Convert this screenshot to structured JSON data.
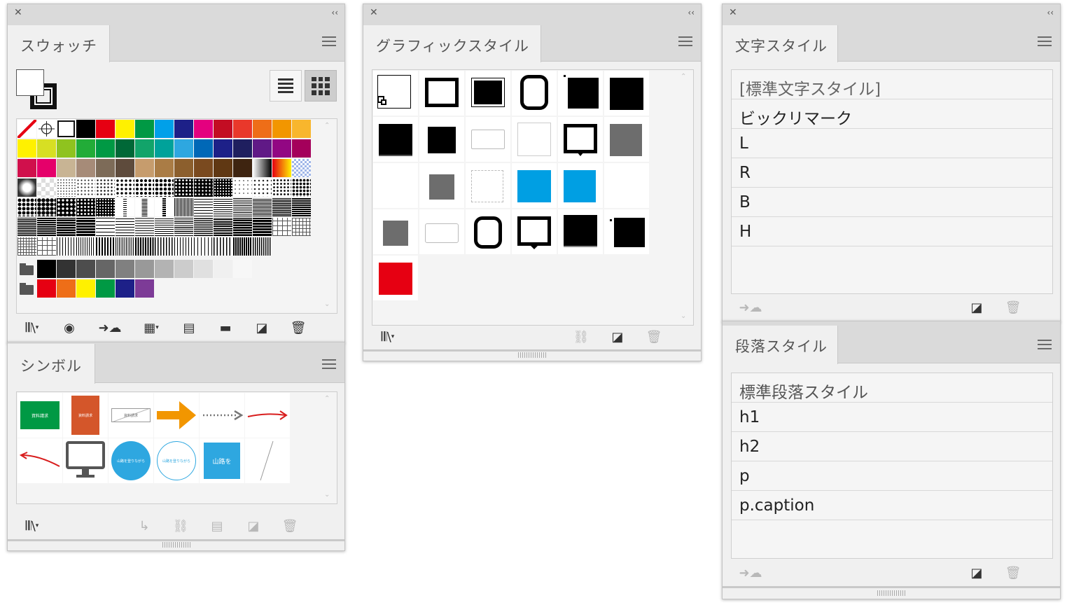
{
  "swatches_panel": {
    "title": "スウォッチ",
    "colors": [
      "#ffffff",
      "#000000",
      "#e60012",
      "#fff100",
      "#009944",
      "#00a0e9",
      "#1d2088",
      "#e4007f",
      "#c30d23",
      "#e9382b",
      "#ee6e18",
      "#f29600",
      "#f8b62d",
      "#fff100",
      "#d7df23",
      "#8fc31f",
      "#22ac38",
      "#009944",
      "#006837",
      "#12a46a",
      "#00a29a",
      "#2ea7e0",
      "#0068b7",
      "#1d2088",
      "#1f1f5f",
      "#601986",
      "#920783",
      "#a4005b",
      "#d0104c",
      "#e5006a",
      "#c8b494",
      "#a68b78",
      "#7d6b58",
      "#5e4b3c",
      "#c69c6d",
      "#aa7c45",
      "#8c5f2d",
      "#7a4a1f",
      "#603813",
      "#3e2410"
    ],
    "grays": [
      "#000000",
      "#333333",
      "#4d4d4d",
      "#666666",
      "#808080",
      "#999999",
      "#b3b3b3",
      "#cccccc",
      "#e0e0e0",
      "#f0f0f0",
      "#f7f7f7"
    ],
    "brights": [
      "#e60012",
      "#ee6e18",
      "#fff100",
      "#009944",
      "#1d2088",
      "#7d3b97"
    ]
  },
  "symbols_panel": {
    "title": "シンボル",
    "items": [
      {
        "label": "資料請求"
      },
      {
        "label": "資料請求"
      },
      {
        "label": "資料請求"
      },
      {
        "label": ""
      },
      {
        "label": ""
      },
      {
        "label": ""
      },
      {
        "label": ""
      },
      {
        "label": ""
      },
      {
        "label": "山路を登りながら"
      },
      {
        "label": "山路を登りながら"
      },
      {
        "label": "山路を"
      },
      {
        "label": ""
      }
    ]
  },
  "graphic_styles_panel": {
    "title": "グラフィックスタイル"
  },
  "char_styles_panel": {
    "title": "文字スタイル",
    "items": [
      "[標準文字スタイル]",
      "ビックリマーク",
      "L",
      "R",
      "B",
      "H"
    ]
  },
  "para_styles_panel": {
    "title": "段落スタイル",
    "items": [
      "標準段落スタイル",
      "h1",
      "h2",
      "p",
      "p.caption"
    ]
  },
  "icons": {
    "close": "✕",
    "collapse": "‹‹",
    "scroll_up": "⌃",
    "scroll_down": "⌄"
  }
}
